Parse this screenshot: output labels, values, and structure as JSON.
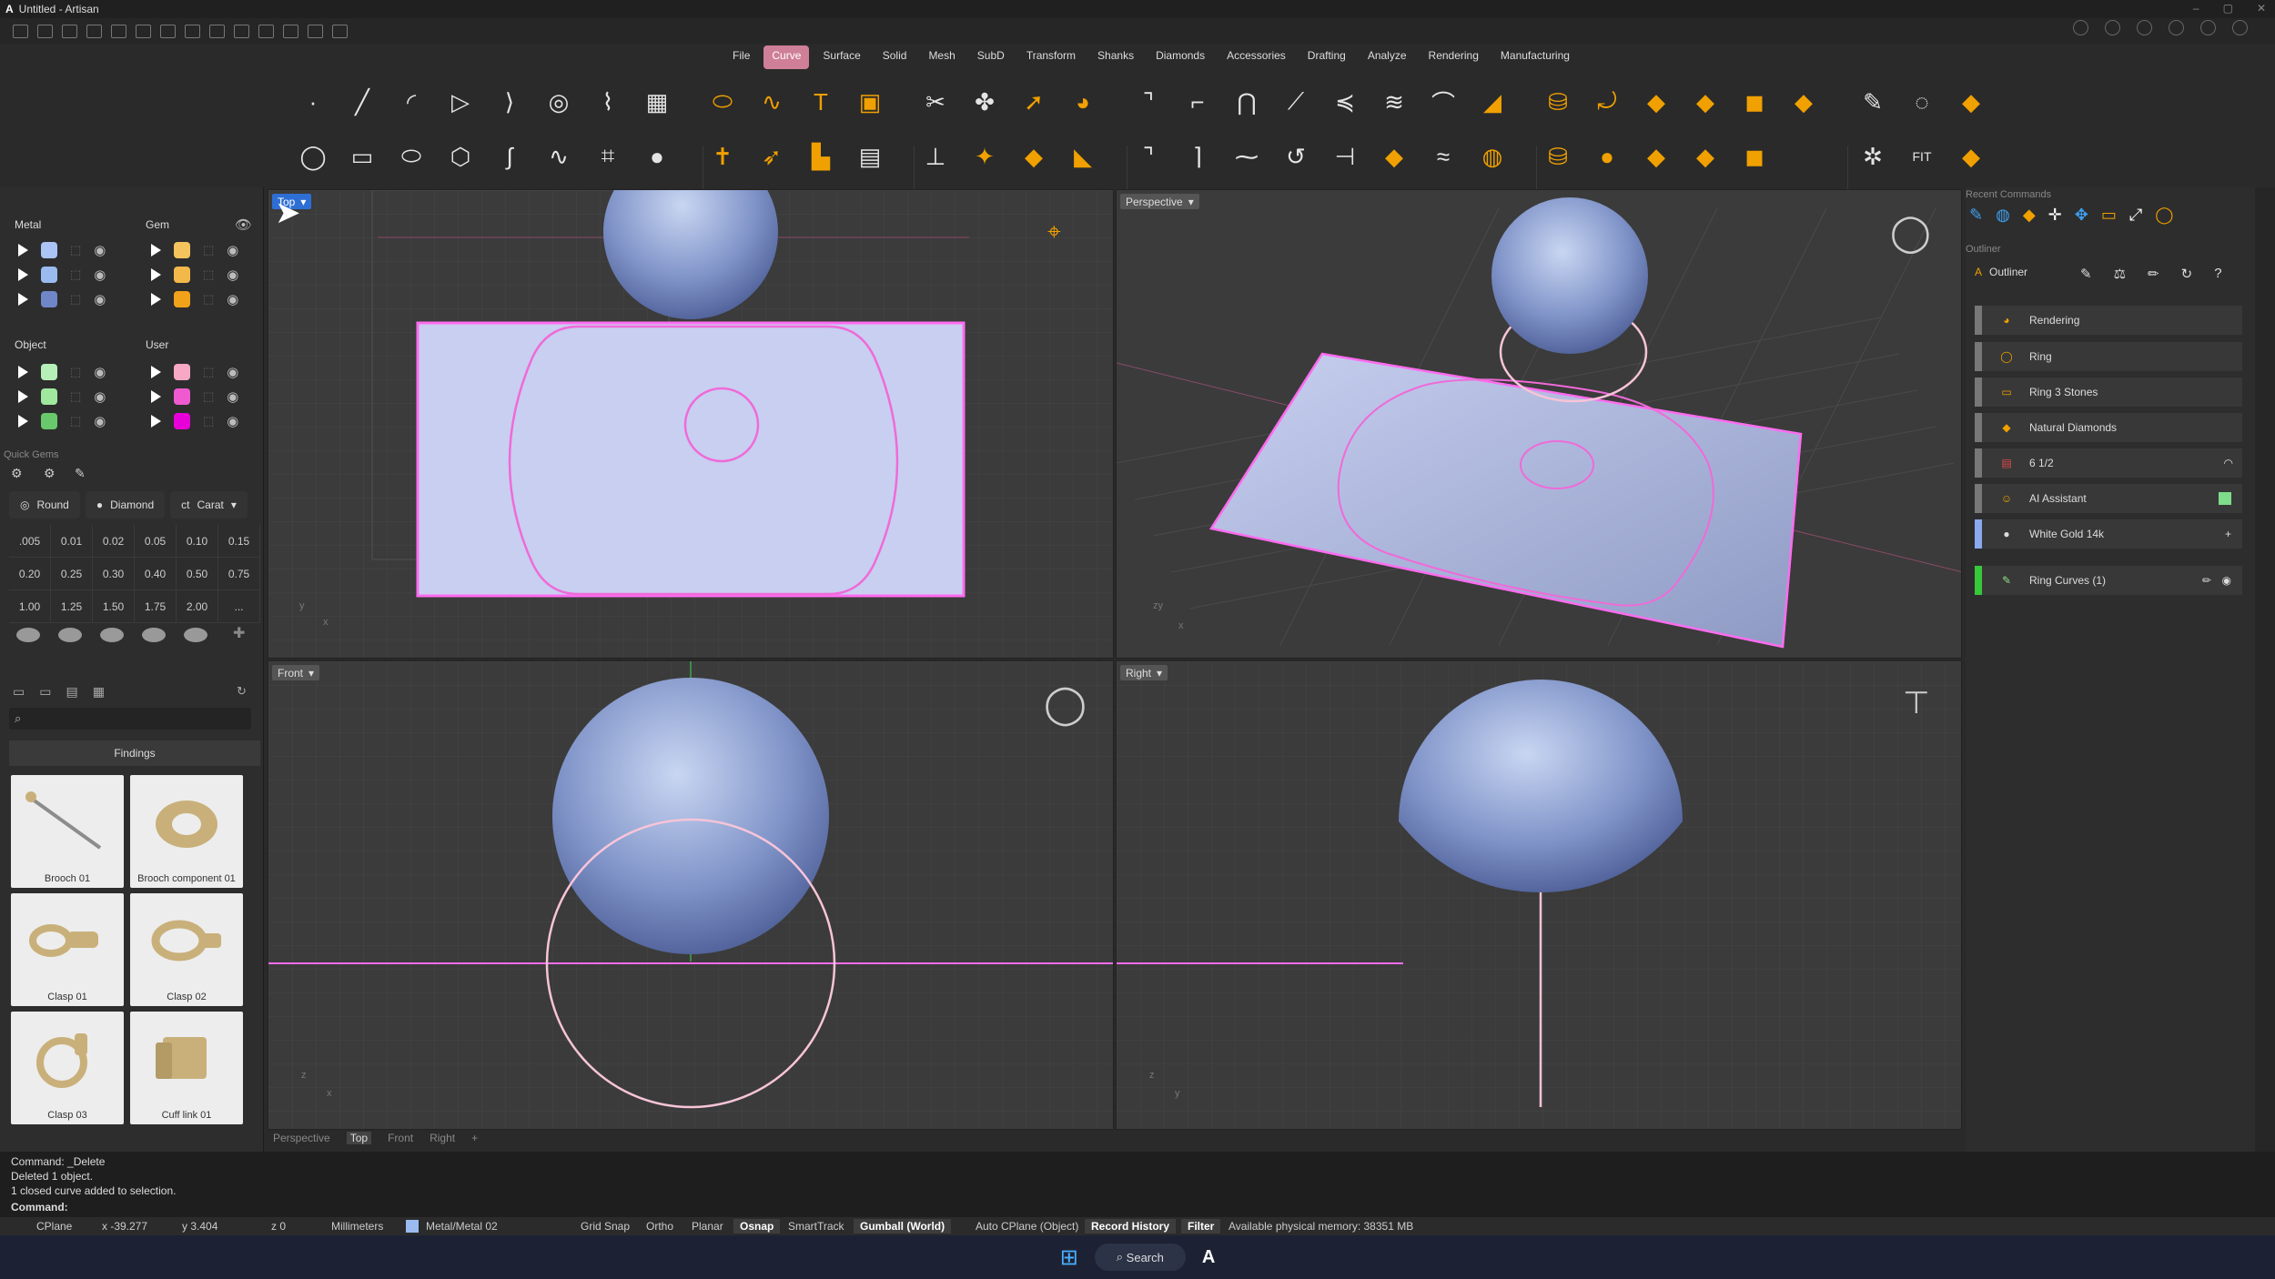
{
  "window": {
    "title": "Untitled - Artisan",
    "logo": "A"
  },
  "menu": [
    "File",
    "Curve",
    "Surface",
    "Solid",
    "Mesh",
    "SubD",
    "Transform",
    "Shanks",
    "Diamonds",
    "Accessories",
    "Drafting",
    "Analyze",
    "Rendering",
    "Manufacturing"
  ],
  "menu_active": "Curve",
  "layers": {
    "metal_label": "Metal",
    "gem_label": "Gem",
    "object_label": "Object",
    "user_label": "User",
    "metal_colors": [
      "#aac4f6",
      "#9bbbf0",
      "#6f86c8"
    ],
    "gem_colors": [
      "#f4c35e",
      "#f3b84a",
      "#f0a21a"
    ],
    "object_colors": [
      "#b6f0b8",
      "#9fe89e",
      "#69c86c"
    ],
    "user_colors": [
      "#f6a8c4",
      "#f05ad0",
      "#e800d8"
    ]
  },
  "quick_gems": {
    "title": "Quick Gems",
    "chips": [
      "Round",
      "Diamond",
      "Carat"
    ],
    "carats": [
      ".005",
      "0.01",
      "0.02",
      "0.05",
      "0.10",
      "0.15",
      "0.20",
      "0.25",
      "0.30",
      "0.40",
      "0.50",
      "0.75",
      "1.00",
      "1.25",
      "1.50",
      "1.75",
      "2.00",
      "..."
    ]
  },
  "library": {
    "category": "Findings",
    "items": [
      "Brooch 01",
      "Brooch component 01",
      "Clasp 01",
      "Clasp 02",
      "Clasp 03",
      "Cuff link 01"
    ]
  },
  "viewports": {
    "top": "Top",
    "perspective": "Perspective",
    "front": "Front",
    "right": "Right"
  },
  "viewport_tabs": [
    "Perspective",
    "Top",
    "Front",
    "Right",
    "+"
  ],
  "viewport_tab_active": "Top",
  "right_panel": {
    "recent_title": "Recent Commands",
    "outliner_section": "Outliner",
    "outliner_title": "Outliner",
    "items": [
      {
        "label": "Rendering",
        "bar": "#777"
      },
      {
        "label": "Ring",
        "bar": "#777"
      },
      {
        "label": "Ring 3 Stones",
        "bar": "#777"
      },
      {
        "label": "Natural Diamonds",
        "bar": "#777"
      },
      {
        "label": "6 1/2",
        "bar": "#777"
      },
      {
        "label": "AI Assistant",
        "bar": "#777"
      },
      {
        "label": "White Gold 14k",
        "bar": "#8aaaf0"
      },
      {
        "label": "Ring Curves (1)",
        "bar": "#37c93a"
      }
    ]
  },
  "command_history": [
    "Command: _Delete",
    "Deleted 1 object.",
    "1 closed curve added to selection."
  ],
  "command_prompt": "Command:",
  "status": {
    "cplane": "CPlane",
    "x": "x -39.277",
    "y": "y 3.404",
    "z": "z 0",
    "units": "Millimeters",
    "layer": "Metal/Metal 02",
    "grid_snap": "Grid Snap",
    "ortho": "Ortho",
    "planar": "Planar",
    "osnap": "Osnap",
    "smarttrack": "SmartTrack",
    "gumball": "Gumball (World)",
    "auto_cplane": "Auto CPlane (Object)",
    "record_history": "Record History",
    "filter": "Filter",
    "memory": "Available physical memory: 38351 MB"
  },
  "taskbar": {
    "search": "Search"
  }
}
